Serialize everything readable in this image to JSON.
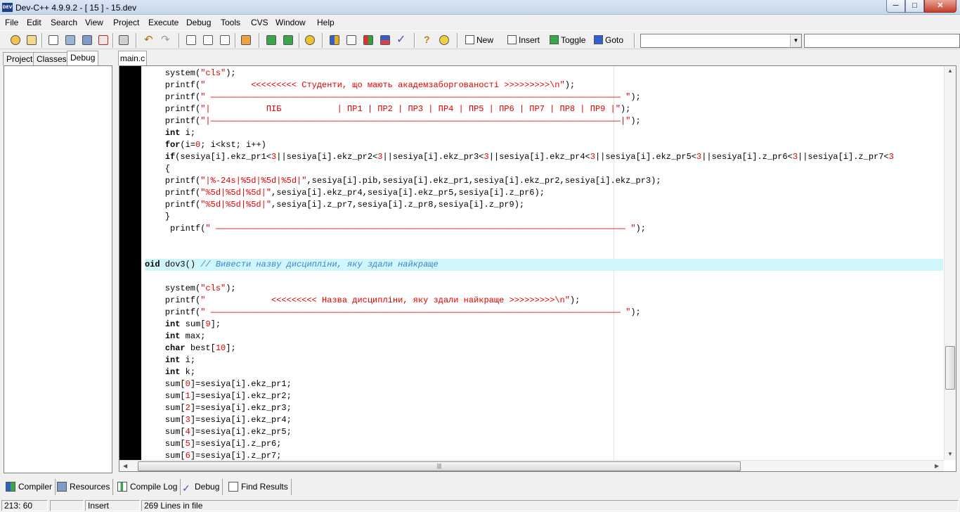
{
  "window": {
    "title": "Dev-C++ 4.9.9.2  - [ 15 ] - 15.dev",
    "app_icon_text": "DEV"
  },
  "menu": [
    "File",
    "Edit",
    "Search",
    "View",
    "Project",
    "Execute",
    "Debug",
    "Tools",
    "CVS",
    "Window",
    "Help"
  ],
  "toolbar": {
    "icons": [
      "open-project-icon",
      "open-file-icon",
      "new-file-icon",
      "save-icon",
      "save-all-icon",
      "close-file-icon",
      "print-icon",
      "undo-icon",
      "redo-icon",
      "find-icon",
      "find-next-icon",
      "replace-icon",
      "goto-line-icon",
      "insert-source-icon",
      "remove-source-icon",
      "compile-icon",
      "compile-run-icon",
      "run-icon",
      "rebuild-icon",
      "debug-icon",
      "help-icon",
      "about-icon"
    ],
    "new_label": "New",
    "insert_label": "Insert",
    "toggle_label": "Toggle",
    "goto_label": "Goto",
    "class_combo_value": "",
    "member_combo_value": ""
  },
  "left_panel": {
    "tabs": [
      "Project",
      "Classes",
      "Debug"
    ],
    "active_tab": "Debug"
  },
  "editor": {
    "tab_label": "main.c",
    "lines": [
      "    system(\"cls\");",
      "    printf(\"         <<<<<<<<< Студенти, що мають академзаборгованості >>>>>>>>>\\n\");",
      "    printf(\" ————————————————————————————————————————————————————————————————————————————————— \");",
      "    printf(\"|           ПІБ           | ПР1 | ПР2 | ПР3 | ПР4 | ПР5 | ПР6 | ПР7 | ПР8 | ПР9 |\");",
      "    printf(\"|—————————————————————————————————————————————————————————————————————————————————|\");",
      "    int i;",
      "    for(i=0; i<kst; i++)",
      "    if(sesiya[i].ekz_pr1<3||sesiya[i].ekz_pr2<3||sesiya[i].ekz_pr3<3||sesiya[i].ekz_pr4<3||sesiya[i].ekz_pr5<3||sesiya[i].z_pr6<3||sesiya[i].z_pr7<3",
      "    {",
      "    printf(\"|%-24s|%5d|%5d|%5d|\",sesiya[i].pib,sesiya[i].ekz_pr1,sesiya[i].ekz_pr2,sesiya[i].ekz_pr3);",
      "    printf(\"%5d|%5d|%5d|\",sesiya[i].ekz_pr4,sesiya[i].ekz_pr5,sesiya[i].z_pr6);",
      "    printf(\"%5d|%5d|%5d|\",sesiya[i].z_pr7,sesiya[i].z_pr8,sesiya[i].z_pr9);",
      "    }",
      "     printf(\" ————————————————————————————————————————————————————————————————————————————————— \");",
      "",
      "",
      "oid dov3() // Вивести назву дисципліни, яку здали найкраще",
      "",
      "    system(\"cls\");",
      "    printf(\"             <<<<<<<<< Назва дисципліни, яку здали найкраще >>>>>>>>>\\n\");",
      "    printf(\" ————————————————————————————————————————————————————————————————————————————————— \");",
      "    int sum[9];",
      "    int max;",
      "    char best[10];",
      "    int i;",
      "    int k;",
      "    sum[0]=sesiya[i].ekz_pr1;",
      "    sum[1]=sesiya[i].ekz_pr2;",
      "    sum[2]=sesiya[i].ekz_pr3;",
      "    sum[3]=sesiya[i].ekz_pr4;",
      "    sum[4]=sesiya[i].ekz_pr5;",
      "    sum[5]=sesiya[i].z_pr6;",
      "    sum[6]=sesiya[i].z_pr7;"
    ],
    "highlighted_line": 16
  },
  "bottom_tabs": [
    "Compiler",
    "Resources",
    "Compile Log",
    "Debug",
    "Find Results"
  ],
  "status": {
    "position": "213: 60",
    "mode": "Insert",
    "lines": "269 Lines in file"
  }
}
